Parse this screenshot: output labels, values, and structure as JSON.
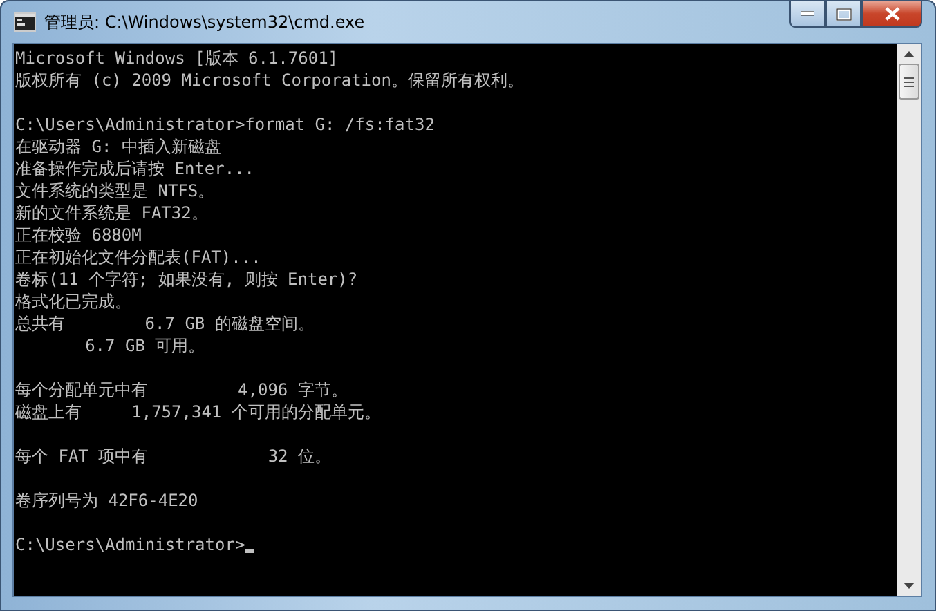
{
  "window": {
    "title": "管理员: C:\\Windows\\system32\\cmd.exe"
  },
  "console": {
    "blocks": [
      {
        "lines": [
          "Microsoft Windows [版本 6.1.7601]",
          "版权所有 (c) 2009 Microsoft Corporation。保留所有权利。"
        ]
      },
      {
        "lines": [
          "C:\\Users\\Administrator>format G: /fs:fat32",
          "在驱动器 G: 中插入新磁盘",
          "准备操作完成后请按 Enter...",
          "文件系统的类型是 NTFS。",
          "新的文件系统是 FAT32。",
          "正在校验 6880M",
          "正在初始化文件分配表(FAT)...",
          "卷标(11 个字符; 如果没有, 则按 Enter)?",
          "格式化已完成。",
          "总共有        6.7 GB 的磁盘空间。",
          "       6.7 GB 可用。"
        ]
      },
      {
        "lines": [
          "每个分配单元中有         4,096 字节。",
          "磁盘上有     1,757,341 个可用的分配单元。"
        ]
      },
      {
        "lines": [
          "每个 FAT 项中有            32 位。"
        ]
      },
      {
        "lines": [
          "卷序列号为 42F6-4E20"
        ]
      },
      {
        "lines": [
          "C:\\Users\\Administrator>"
        ],
        "cursor": true
      }
    ]
  }
}
